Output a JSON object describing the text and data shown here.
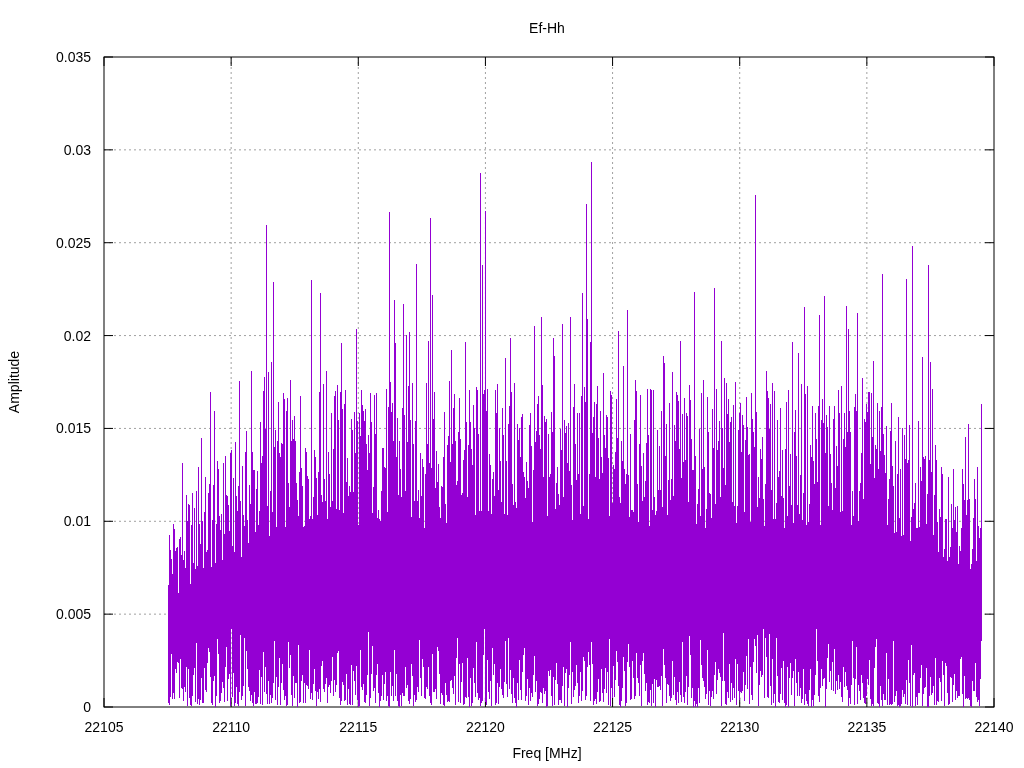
{
  "chart_data": {
    "type": "line",
    "title": "Ef-Hh",
    "xlabel": "Freq [MHz]",
    "ylabel": "Amplitude",
    "grid": true,
    "xlim": [
      22105,
      22140
    ],
    "ylim": [
      0,
      0.035
    ],
    "xticks": [
      {
        "value": 22105,
        "label": "22105"
      },
      {
        "value": 22110,
        "label": "22110"
      },
      {
        "value": 22115,
        "label": "22115"
      },
      {
        "value": 22120,
        "label": "22120"
      },
      {
        "value": 22125,
        "label": "22125"
      },
      {
        "value": 22130,
        "label": "22130"
      },
      {
        "value": 22135,
        "label": "22135"
      },
      {
        "value": 22140,
        "label": "22140"
      }
    ],
    "yticks": [
      0,
      0.005,
      0.01,
      0.015,
      0.02,
      0.025,
      0.03,
      0.035
    ]
  }
}
